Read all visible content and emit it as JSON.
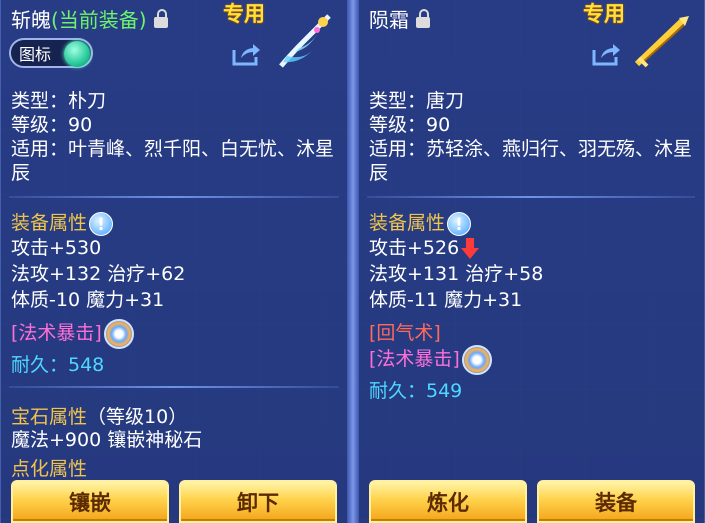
{
  "left": {
    "name": "斩魄",
    "equipped_note": "(当前装备)",
    "exclusive": "专用",
    "toggle_label": "图标",
    "type_line": "类型：朴刀",
    "level_line": "等级：90",
    "applicable_line": "适用：叶青峰、烈千阳、白无忧、沐星辰",
    "attr_title": "装备属性",
    "stat1": "攻击+530",
    "stat2": "法攻+132 治疗+62",
    "stat3": "体质-10 魔力+31",
    "special1": "[法术暴击]",
    "durability": "耐久：548",
    "gem_title": "宝石属性",
    "gem_level": "（等级10）",
    "gem_stat": "魔法+900 镶嵌神秘石",
    "refine_title": "点化属性",
    "btn1": "镶嵌",
    "btn2": "卸下"
  },
  "right": {
    "name": "陨霜",
    "exclusive": "专用",
    "type_line": "类型：唐刀",
    "level_line": "等级：90",
    "applicable_line": "适用：苏轻涂、燕归行、羽无殇、沐星辰",
    "attr_title": "装备属性",
    "stat1": "攻击+526",
    "stat2": "法攻+131 治疗+58",
    "stat3": "体质-11 魔力+31",
    "special1": "[回气术]",
    "special2": "[法术暴击]",
    "durability": "耐久：549",
    "btn1": "炼化",
    "btn2": "装备"
  },
  "colors": {
    "panel": "#263a84",
    "section_title": "#f0c34a",
    "special": "#ff6fd7",
    "durability": "#4fd8ff",
    "button": "#ffd24c"
  }
}
